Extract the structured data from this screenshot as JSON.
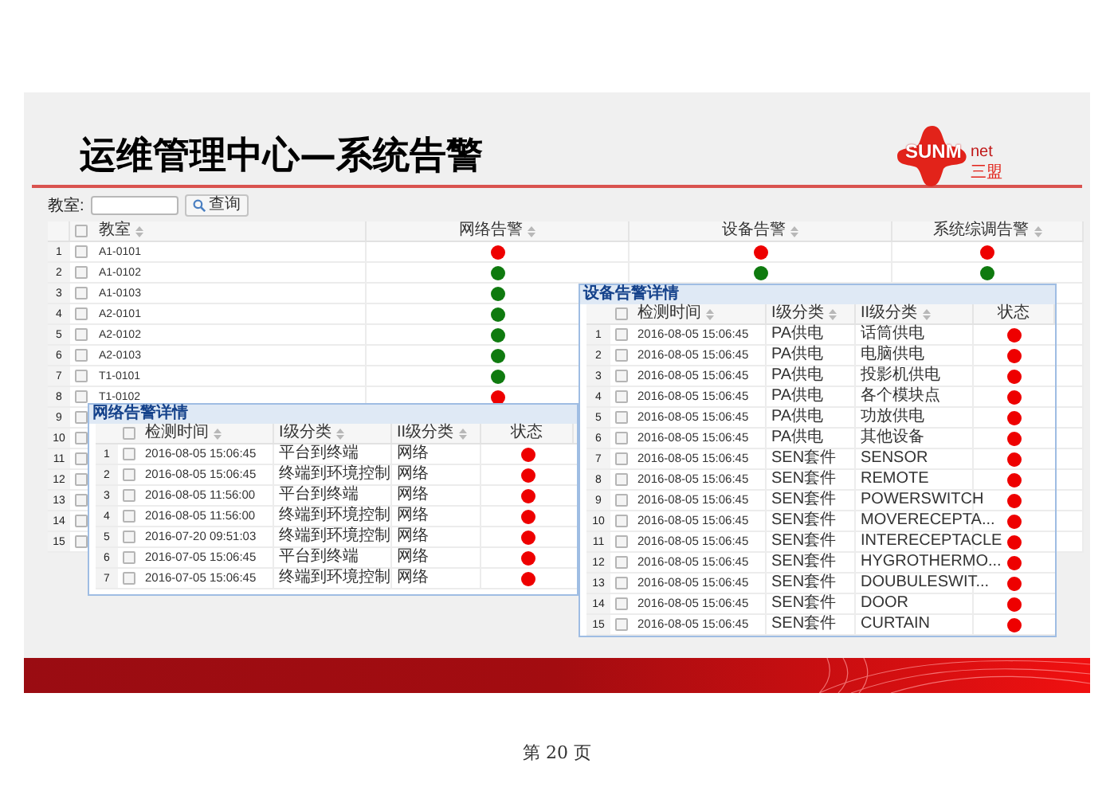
{
  "slide_title": "运维管理中心—系统告警",
  "logo": {
    "brand": "SUNM",
    "suffix": "net",
    "sub": "三盟"
  },
  "search": {
    "label": "教室:",
    "button": "查询"
  },
  "main_table": {
    "header_checked": false,
    "columns": [
      {
        "label": "教室",
        "sortable": true
      },
      {
        "label": "网络告警",
        "sortable": true
      },
      {
        "label": "设备告警",
        "sortable": true
      },
      {
        "label": "系统综调告警",
        "sortable": true
      }
    ],
    "rows": [
      {
        "num": "1",
        "checked": false,
        "room": "A1-0101",
        "alerts": [
          {
            "color": "#ee0000"
          },
          {
            "color": "#ee0000"
          },
          {
            "color": "#ee0000"
          }
        ]
      },
      {
        "num": "2",
        "checked": false,
        "room": "A1-0102",
        "alerts": [
          {
            "color": "#0f7a0f"
          },
          {
            "color": "#0f7a0f"
          },
          {
            "color": "#0f7a0f"
          }
        ]
      },
      {
        "num": "3",
        "checked": false,
        "room": "A1-0103",
        "alerts": [
          {
            "color": "#0f7a0f"
          }
        ]
      },
      {
        "num": "4",
        "checked": false,
        "room": "A2-0101",
        "alerts": [
          {
            "color": "#0f7a0f"
          }
        ]
      },
      {
        "num": "5",
        "checked": false,
        "room": "A2-0102",
        "alerts": [
          {
            "color": "#0f7a0f"
          }
        ]
      },
      {
        "num": "6",
        "checked": false,
        "room": "A2-0103",
        "alerts": [
          {
            "color": "#0f7a0f"
          }
        ]
      },
      {
        "num": "7",
        "checked": false,
        "room": "T1-0101",
        "alerts": [
          {
            "color": "#0f7a0f"
          }
        ]
      },
      {
        "num": "8",
        "checked": false,
        "room": "T1-0102",
        "alerts": [
          {
            "color": "#ee0000"
          }
        ]
      },
      {
        "num": "9",
        "checked": false
      },
      {
        "num": "10",
        "checked": false
      },
      {
        "num": "11",
        "checked": false
      },
      {
        "num": "12",
        "checked": false
      },
      {
        "num": "13",
        "checked": false
      },
      {
        "num": "14",
        "checked": false
      },
      {
        "num": "15",
        "checked": false
      }
    ]
  },
  "network_panel": {
    "title": "网络告警详情",
    "header_checked": false,
    "columns": [
      {
        "label": "检测时间",
        "sortable": true
      },
      {
        "label": "I级分类",
        "sortable": true
      },
      {
        "label": "II级分类",
        "sortable": true
      },
      {
        "label": "状态",
        "sortable": false
      }
    ],
    "rows": [
      {
        "num": "1",
        "checked": false,
        "time": "2016-08-05 15:06:45",
        "level1": "平台到终端",
        "level2": "网络",
        "color": "#ee0000"
      },
      {
        "num": "2",
        "checked": false,
        "time": "2016-08-05 15:06:45",
        "level1": "终端到环境控制",
        "level2": "网络",
        "color": "#ee0000"
      },
      {
        "num": "3",
        "checked": false,
        "time": "2016-08-05 11:56:00",
        "level1": "平台到终端",
        "level2": "网络",
        "color": "#ee0000"
      },
      {
        "num": "4",
        "checked": false,
        "time": "2016-08-05 11:56:00",
        "level1": "终端到环境控制",
        "level2": "网络",
        "color": "#ee0000"
      },
      {
        "num": "5",
        "checked": false,
        "time": "2016-07-20 09:51:03",
        "level1": "终端到环境控制",
        "level2": "网络",
        "color": "#ee0000"
      },
      {
        "num": "6",
        "checked": false,
        "time": "2016-07-05 15:06:45",
        "level1": "平台到终端",
        "level2": "网络",
        "color": "#ee0000"
      },
      {
        "num": "7",
        "checked": false,
        "time": "2016-07-05 15:06:45",
        "level1": "终端到环境控制",
        "level2": "网络",
        "color": "#ee0000"
      }
    ]
  },
  "device_panel": {
    "title": "设备告警详情",
    "header_checked": false,
    "columns": [
      {
        "label": "检测时间",
        "sortable": true
      },
      {
        "label": "I级分类",
        "sortable": true
      },
      {
        "label": "II级分类",
        "sortable": true
      },
      {
        "label": "状态",
        "sortable": false
      }
    ],
    "rows": [
      {
        "num": "1",
        "checked": false,
        "time": "2016-08-05 15:06:45",
        "level1": "PA供电",
        "level2": "话筒供电",
        "color": "#ee0000"
      },
      {
        "num": "2",
        "checked": false,
        "time": "2016-08-05 15:06:45",
        "level1": "PA供电",
        "level2": "电脑供电",
        "color": "#ee0000"
      },
      {
        "num": "3",
        "checked": false,
        "time": "2016-08-05 15:06:45",
        "level1": "PA供电",
        "level2": "投影机供电",
        "color": "#ee0000"
      },
      {
        "num": "4",
        "checked": false,
        "time": "2016-08-05 15:06:45",
        "level1": "PA供电",
        "level2": "各个模块点",
        "color": "#ee0000"
      },
      {
        "num": "5",
        "checked": false,
        "time": "2016-08-05 15:06:45",
        "level1": "PA供电",
        "level2": "功放供电",
        "color": "#ee0000"
      },
      {
        "num": "6",
        "checked": false,
        "time": "2016-08-05 15:06:45",
        "level1": "PA供电",
        "level2": "其他设备",
        "color": "#ee0000"
      },
      {
        "num": "7",
        "checked": false,
        "time": "2016-08-05 15:06:45",
        "level1": "SEN套件",
        "level2": "SENSOR",
        "color": "#ee0000"
      },
      {
        "num": "8",
        "checked": false,
        "time": "2016-08-05 15:06:45",
        "level1": "SEN套件",
        "level2": "REMOTE",
        "color": "#ee0000"
      },
      {
        "num": "9",
        "checked": false,
        "time": "2016-08-05 15:06:45",
        "level1": "SEN套件",
        "level2": "POWERSWITCH",
        "color": "#ee0000"
      },
      {
        "num": "10",
        "checked": false,
        "time": "2016-08-05 15:06:45",
        "level1": "SEN套件",
        "level2": "MOVERECEPTA...",
        "color": "#ee0000"
      },
      {
        "num": "11",
        "checked": false,
        "time": "2016-08-05 15:06:45",
        "level1": "SEN套件",
        "level2": "INTERECEPTACLE",
        "color": "#ee0000"
      },
      {
        "num": "12",
        "checked": false,
        "time": "2016-08-05 15:06:45",
        "level1": "SEN套件",
        "level2": "HYGROTHERMO...",
        "color": "#ee0000"
      },
      {
        "num": "13",
        "checked": false,
        "time": "2016-08-05 15:06:45",
        "level1": "SEN套件",
        "level2": "DOUBULESWIT...",
        "color": "#ee0000"
      },
      {
        "num": "14",
        "checked": false,
        "time": "2016-08-05 15:06:45",
        "level1": "SEN套件",
        "level2": "DOOR",
        "color": "#ee0000"
      },
      {
        "num": "15",
        "checked": false,
        "time": "2016-08-05 15:06:45",
        "level1": "SEN套件",
        "level2": "CURTAIN",
        "color": "#ee0000"
      }
    ]
  },
  "page_footer": "第 20 页"
}
